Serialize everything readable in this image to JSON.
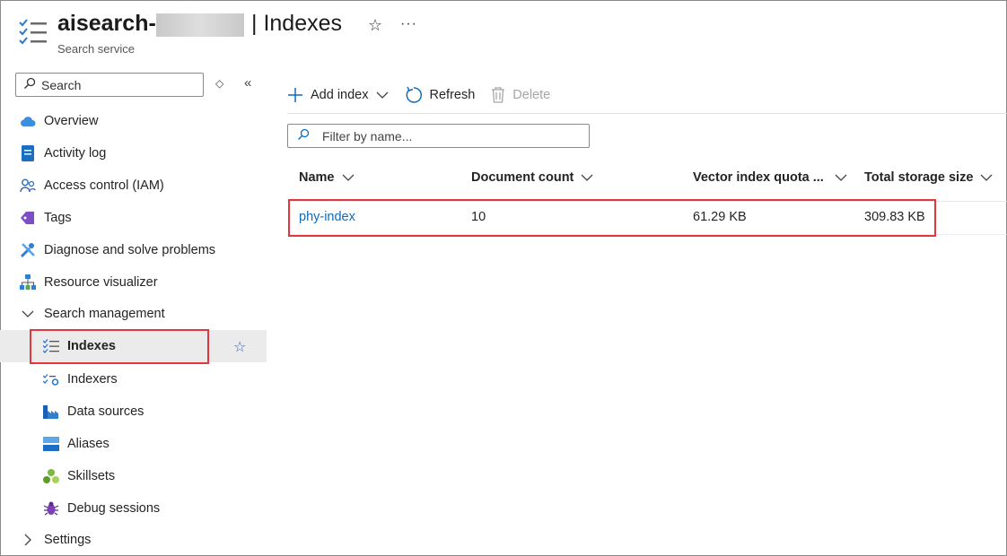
{
  "header": {
    "title_prefix": "aisearch-",
    "section": "| Indexes",
    "subtitle": "Search service"
  },
  "sidebar": {
    "search_placeholder": "Search",
    "items": [
      {
        "label": "Overview",
        "icon": "cloud-icon"
      },
      {
        "label": "Activity log",
        "icon": "activity-log-icon"
      },
      {
        "label": "Access control (IAM)",
        "icon": "people-icon"
      },
      {
        "label": "Tags",
        "icon": "tag-icon"
      },
      {
        "label": "Diagnose and solve problems",
        "icon": "wrench-icon"
      },
      {
        "label": "Resource visualizer",
        "icon": "hierarchy-icon"
      },
      {
        "label": "Search management",
        "icon": "chevron-down-icon"
      },
      {
        "label": "Indexes",
        "icon": "index-list-icon",
        "selected": true
      },
      {
        "label": "Indexers",
        "icon": "indexer-icon"
      },
      {
        "label": "Data sources",
        "icon": "data-source-icon"
      },
      {
        "label": "Aliases",
        "icon": "alias-icon"
      },
      {
        "label": "Skillsets",
        "icon": "skillset-icon"
      },
      {
        "label": "Debug sessions",
        "icon": "bug-icon"
      },
      {
        "label": "Settings",
        "icon": "chevron-right-icon"
      }
    ]
  },
  "toolbar": {
    "add_index": "Add index",
    "refresh": "Refresh",
    "delete": "Delete"
  },
  "filter": {
    "placeholder": "Filter by name..."
  },
  "table": {
    "columns": [
      "Name",
      "Document count",
      "Vector index quota ...",
      "Total storage size"
    ],
    "rows": [
      {
        "name": "phy-index",
        "document_count": "10",
        "vector_quota": "61.29 KB",
        "storage": "309.83 KB"
      }
    ]
  },
  "colors": {
    "accent": "#0f6cbd",
    "highlight": "#e0383e"
  }
}
